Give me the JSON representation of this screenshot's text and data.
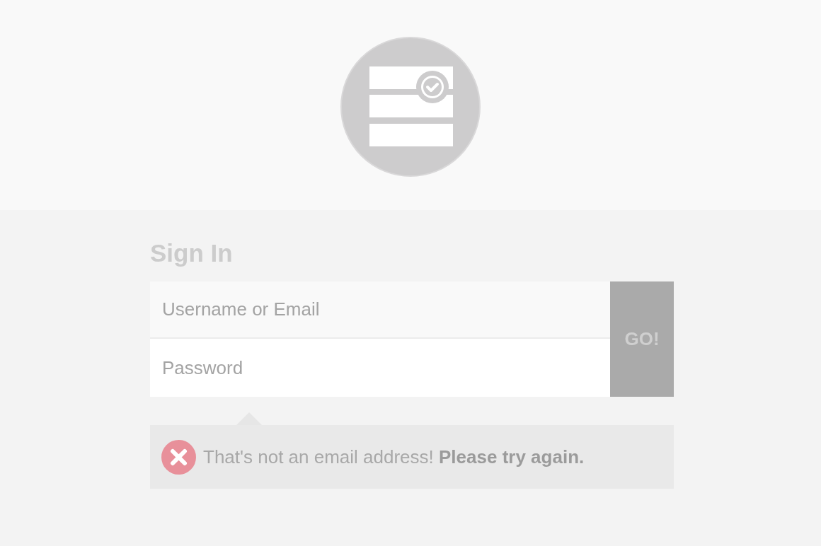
{
  "title": "Sign In",
  "fields": [
    {
      "placeholder": "Username or Email"
    },
    {
      "placeholder": "Password"
    }
  ],
  "submit_button": "GO!",
  "error": {
    "message": "That's not an email address! **Please try again.**"
  }
}
